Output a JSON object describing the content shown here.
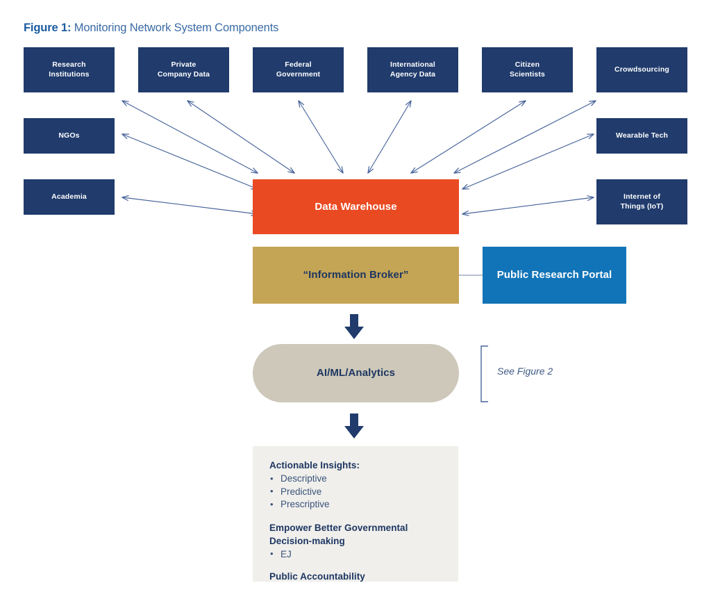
{
  "figure": {
    "label": "Figure 1:",
    "title": "Monitoring Network System Components"
  },
  "colors": {
    "navy": "#203b6c",
    "orange": "#ea4a22",
    "gold": "#c4a455",
    "blue": "#1274b8",
    "taupe": "#cdc8b9",
    "panel_gray": "#f0efec",
    "arrow_line": "#46639a",
    "caption_blue": "#2e5c9a",
    "text_navy": "#1d3661"
  },
  "sources": {
    "top_row": [
      {
        "label": "Research\nInstitutions",
        "name": "research-institutions"
      },
      {
        "label": "Private\nCompany Data",
        "name": "private-company-data"
      },
      {
        "label": "Federal\nGovernment",
        "name": "federal-government"
      },
      {
        "label": "International\nAgency Data",
        "name": "international-agency-data"
      },
      {
        "label": "Citizen\nScientists",
        "name": "citizen-scientists"
      },
      {
        "label": "Crowdsourcing",
        "name": "crowdsourcing"
      }
    ],
    "left_column": [
      {
        "label": "NGOs",
        "name": "ngos"
      },
      {
        "label": "Academia",
        "name": "academia"
      }
    ],
    "right_column": [
      {
        "label": "Wearable Tech",
        "name": "wearable-tech"
      },
      {
        "label": "Internet of\nThings (IoT)",
        "name": "internet-of-things"
      }
    ]
  },
  "core": {
    "warehouse": "Data Warehouse",
    "broker": "“Information Broker”",
    "portal": "Public Research Portal",
    "analytics": "AI/ML/Analytics",
    "see_figure": "See Figure 2"
  },
  "insights": {
    "heading": "Actionable Insights:",
    "items": [
      "Descriptive",
      "Predictive",
      "Prescriptive"
    ],
    "heading2_line1": "Empower Better Governmental",
    "heading2_line2": "Decision-making",
    "items2": [
      "EJ"
    ],
    "heading3": "Public Accountability"
  },
  "diagram_structure": {
    "type": "flow-diagram",
    "bidirectional_links": [
      "Research Institutions ↔ Data Warehouse",
      "Private Company Data ↔ Data Warehouse",
      "Federal Government ↔ Data Warehouse",
      "International Agency Data ↔ Data Warehouse",
      "Citizen Scientists ↔ Data Warehouse",
      "Crowdsourcing ↔ Data Warehouse",
      "NGOs ↔ Data Warehouse",
      "Academia ↔ Data Warehouse",
      "Wearable Tech ↔ Data Warehouse",
      "Internet of Things (IoT) ↔ Data Warehouse"
    ],
    "plain_links": [
      "“Information Broker” — Public Research Portal"
    ],
    "downward_flow": [
      "“Information Broker” ↓ AI/ML/Analytics",
      "AI/ML/Analytics ↓ Actionable Insights"
    ]
  }
}
